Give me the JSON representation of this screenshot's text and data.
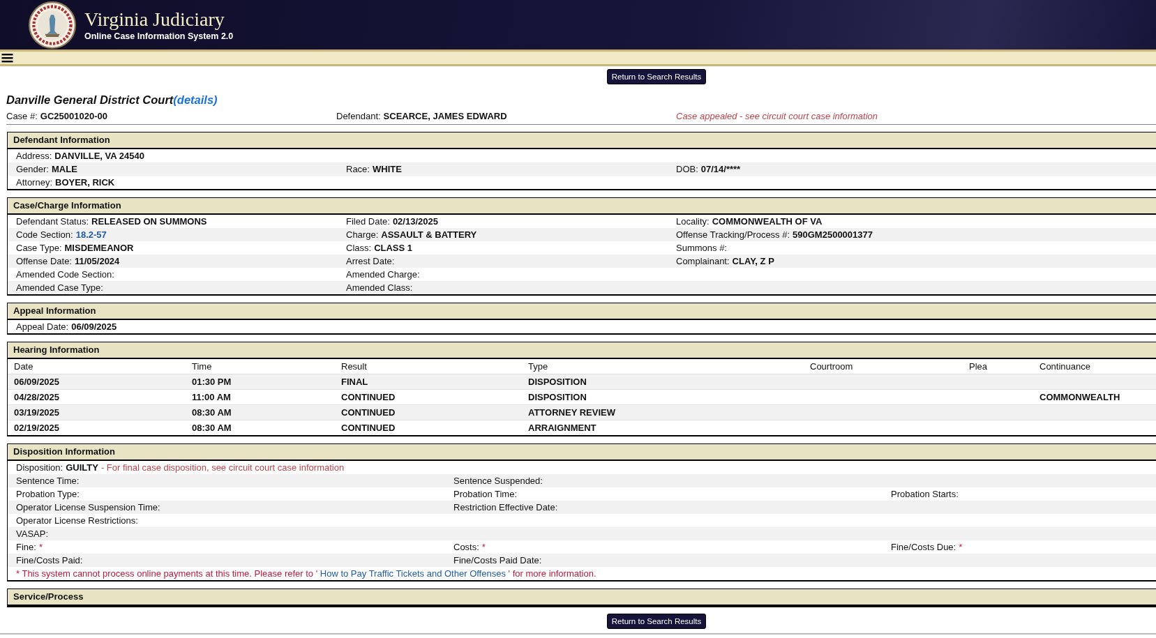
{
  "header": {
    "title": "Virginia Judiciary",
    "subtitle": "Online Case Information System 2.0"
  },
  "top_button": "Return to Search Results",
  "court": {
    "name": "Danville General District Court",
    "details_link": "(details)"
  },
  "case_line": {
    "fields": [
      {
        "label": "Case #:",
        "value": "GC25001020-00"
      },
      {
        "label": "Defendant:",
        "value": "SCEARCE, JAMES EDWARD"
      }
    ],
    "notice": "Case appealed - see circuit court case information"
  },
  "sections": [
    {
      "kind": "fields",
      "title": "Defendant Information",
      "rows": [
        {
          "kind": "fields",
          "cells": [
            {
              "label": "Address:",
              "value": "DANVILLE, VA 24540"
            }
          ]
        },
        {
          "kind": "fields",
          "cells": [
            {
              "label": "Gender:",
              "value": "MALE"
            },
            {
              "label": "Race:",
              "value": "WHITE"
            },
            {
              "label": "DOB:",
              "value": "07/14/****"
            }
          ]
        },
        {
          "kind": "fields",
          "cells": [
            {
              "label": "Attorney:",
              "value": "BOYER, RICK"
            }
          ]
        }
      ]
    },
    {
      "kind": "fields",
      "title": "Case/Charge Information",
      "rows": [
        {
          "kind": "fields",
          "cells": [
            {
              "label": "Defendant Status:",
              "value": "RELEASED ON SUMMONS"
            },
            {
              "label": "Filed Date:",
              "value": "02/13/2025"
            },
            {
              "label": "Locality:",
              "value": "COMMONWEALTH OF VA"
            }
          ]
        },
        {
          "kind": "fields",
          "cells": [
            {
              "label": "Code Section:",
              "value": "18.2-57",
              "kind": "link"
            },
            {
              "label": "Charge:",
              "value": "ASSAULT & BATTERY"
            },
            {
              "label": "Offense Tracking/Process #:",
              "value": "590GM2500001377"
            }
          ]
        },
        {
          "kind": "fields",
          "cells": [
            {
              "label": "Case Type:",
              "value": "MISDEMEANOR"
            },
            {
              "label": "Class:",
              "value": "CLASS 1"
            },
            {
              "label": "Summons #:"
            }
          ]
        },
        {
          "kind": "fields",
          "cells": [
            {
              "label": "Offense Date:",
              "value": "11/05/2024"
            },
            {
              "label": "Arrest Date:"
            },
            {
              "label": "Complainant:",
              "value": "CLAY, Z P"
            }
          ]
        },
        {
          "kind": "fields",
          "cells": [
            {
              "label": "Amended Code Section:"
            },
            {
              "label": "Amended Charge:"
            }
          ]
        },
        {
          "kind": "fields",
          "cells": [
            {
              "label": "Amended Case Type:"
            },
            {
              "label": "Amended Class:"
            }
          ]
        }
      ]
    },
    {
      "kind": "fields",
      "title": "Appeal Information",
      "rows": [
        {
          "kind": "fields",
          "cells": [
            {
              "label": "Appeal Date:",
              "value": "06/09/2025"
            }
          ]
        }
      ]
    },
    {
      "kind": "table",
      "title": "Hearing Information",
      "columns": [
        "Date",
        "Time",
        "Result",
        "Type",
        "Courtroom",
        "Plea",
        "Continuance"
      ],
      "rows": [
        [
          "06/09/2025",
          "01:30 PM",
          "FINAL",
          "DISPOSITION",
          "",
          "",
          ""
        ],
        [
          "04/28/2025",
          "11:00 AM",
          "CONTINUED",
          "DISPOSITION",
          "",
          "",
          "COMMONWEALTH"
        ],
        [
          "03/19/2025",
          "08:30 AM",
          "CONTINUED",
          "ATTORNEY REVIEW",
          "",
          "",
          ""
        ],
        [
          "02/19/2025",
          "08:30 AM",
          "CONTINUED",
          "ARRAIGNMENT",
          "",
          "",
          ""
        ]
      ]
    },
    {
      "kind": "wide-fields",
      "title": "Disposition Information",
      "rows": [
        {
          "kind": "fields",
          "cells": [
            {
              "label": "Disposition:",
              "value": "GUILTY",
              "note": "- For final case disposition, see circuit court case information"
            }
          ]
        },
        {
          "kind": "fields",
          "cells": [
            {
              "label": "Sentence Time:"
            },
            {
              "label": "Sentence Suspended:"
            }
          ]
        },
        {
          "kind": "fields",
          "cells": [
            {
              "label": "Probation Type:"
            },
            {
              "label": "Probation Time:"
            },
            {
              "label": "Probation Starts:"
            }
          ]
        },
        {
          "kind": "fields",
          "cells": [
            {
              "label": "Operator License Suspension Time:"
            },
            {
              "label": "Restriction Effective Date:"
            }
          ]
        },
        {
          "kind": "fields",
          "cells": [
            {
              "label": "Operator License Restrictions:"
            }
          ]
        },
        {
          "kind": "fields",
          "cells": [
            {
              "label": "VASAP:"
            }
          ]
        },
        {
          "kind": "fields",
          "cells": [
            {
              "label": "Fine:",
              "value": "*",
              "kind": "required"
            },
            {
              "label": "Costs:",
              "value": "*",
              "kind": "required"
            },
            {
              "label": "Fine/Costs Due:",
              "value": "*",
              "kind": "required"
            }
          ]
        },
        {
          "kind": "fields",
          "cells": [
            {
              "label": "Fine/Costs Paid:"
            },
            {
              "label": "Fine/Costs Paid Date:"
            }
          ]
        },
        {
          "kind": "notice",
          "before": "* This system cannot process online payments at this time. Please refer to '",
          "link": "How to Pay Traffic Tickets and Other Offenses",
          "after": "' for more information."
        }
      ]
    },
    {
      "kind": "header",
      "title": "Service/Process"
    }
  ],
  "bottom_button": "Return to Search Results"
}
